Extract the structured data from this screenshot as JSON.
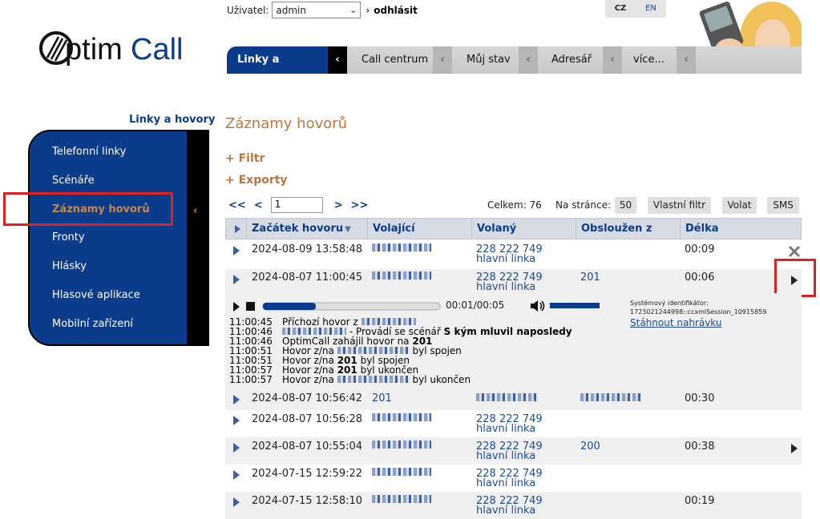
{
  "header": {
    "logo_text": "OptimCall",
    "user_label": "Uživatel:",
    "user_value": "admin",
    "logout": "odhlásit",
    "lang_active": "CZ",
    "lang_other": "EN"
  },
  "tabs": [
    {
      "label": "Linky a hovory",
      "active": true
    },
    {
      "label": "Call centrum"
    },
    {
      "label": "Můj stav"
    },
    {
      "label": "Adresář"
    },
    {
      "label": "více..."
    }
  ],
  "sidebar": {
    "title": "Linky a hovory",
    "items": [
      {
        "label": "Telefonní linky"
      },
      {
        "label": "Scénáře"
      },
      {
        "label": "Záznamy hovorů",
        "active": true
      },
      {
        "label": "Fronty"
      },
      {
        "label": "Hlásky"
      },
      {
        "label": "Hlasové aplikace"
      },
      {
        "label": "Mobilní zařízení"
      }
    ]
  },
  "main": {
    "title": "Záznamy hovorů",
    "filter": "+ Filtr",
    "exports": "+ Exporty",
    "pager": {
      "first": "<<",
      "prev": "<",
      "page": "1",
      "next": ">",
      "last": ">>"
    },
    "total": "Celkem: 76",
    "per_page_label": "Na stránce:",
    "per_page": "50",
    "btn_custom_filter": "Vlastní filtr",
    "btn_call": "Volat",
    "btn_sms": "SMS"
  },
  "table": {
    "headers": {
      "start": "Začátek hovoru",
      "caller": "Volající",
      "called": "Volaný",
      "served": "Obsloužen z",
      "duration": "Délka"
    },
    "rows": [
      {
        "start": "2024-08-09 13:58:48",
        "called": "228 222 749",
        "called_sub": "hlavní linka",
        "served": "",
        "duration": "00:09"
      },
      {
        "start": "2024-08-07 11:00:45",
        "called": "228 222 749",
        "called_sub": "hlavní linka",
        "served": "201",
        "duration": "00:06"
      },
      {
        "start": "2024-08-07 10:56:42",
        "caller": "201",
        "called": "",
        "called_sub": "",
        "served": "",
        "duration": "00:30"
      },
      {
        "start": "2024-08-07 10:56:28",
        "called": "228 222 749",
        "called_sub": "hlavní linka",
        "served": "",
        "duration": ""
      },
      {
        "start": "2024-08-07 10:55:04",
        "called": "228 222 749",
        "called_sub": "hlavní linka",
        "served": "200",
        "duration": "00:38"
      },
      {
        "start": "2024-07-15 12:59:22",
        "called": "228 222 749",
        "called_sub": "hlavní linka",
        "served": "",
        "duration": ""
      },
      {
        "start": "2024-07-15 12:58:10",
        "called": "228 222 749",
        "called_sub": "hlavní linka",
        "served": "",
        "duration": "00:19"
      }
    ]
  },
  "player": {
    "time": "00:01/00:05",
    "progress": 0.3,
    "volume": 1.0,
    "sysid_label": "Systémový identifikátor:",
    "sysid_value": "1723021244998::ccxmlSession_10915859",
    "download": "Stáhnout nahrávku"
  },
  "log": [
    {
      "t": "11:00:45",
      "a": "Příchozí hovor z",
      "b": "",
      "c": ""
    },
    {
      "t": "11:00:46",
      "a": "",
      "b": "- Provádí se scénář",
      "c": "S kým mluvil naposledy"
    },
    {
      "t": "11:00:46",
      "a": "OptimCall zahájil hovor na",
      "b": "",
      "c": "201"
    },
    {
      "t": "11:00:51",
      "a": "Hovor z/na",
      "b": "byl spojen",
      "c": ""
    },
    {
      "t": "11:00:51",
      "a": "Hovor z/na",
      "b": "byl spojen",
      "c": "201"
    },
    {
      "t": "11:00:57",
      "a": "Hovor z/na",
      "b": "byl ukončen",
      "c": "201"
    },
    {
      "t": "11:00:57",
      "a": "Hovor z/na",
      "b": "byl ukončen",
      "c": ""
    }
  ],
  "colors": {
    "primary": "#0b3c8c",
    "accent": "#b9773d",
    "highlight": "#e02020"
  }
}
